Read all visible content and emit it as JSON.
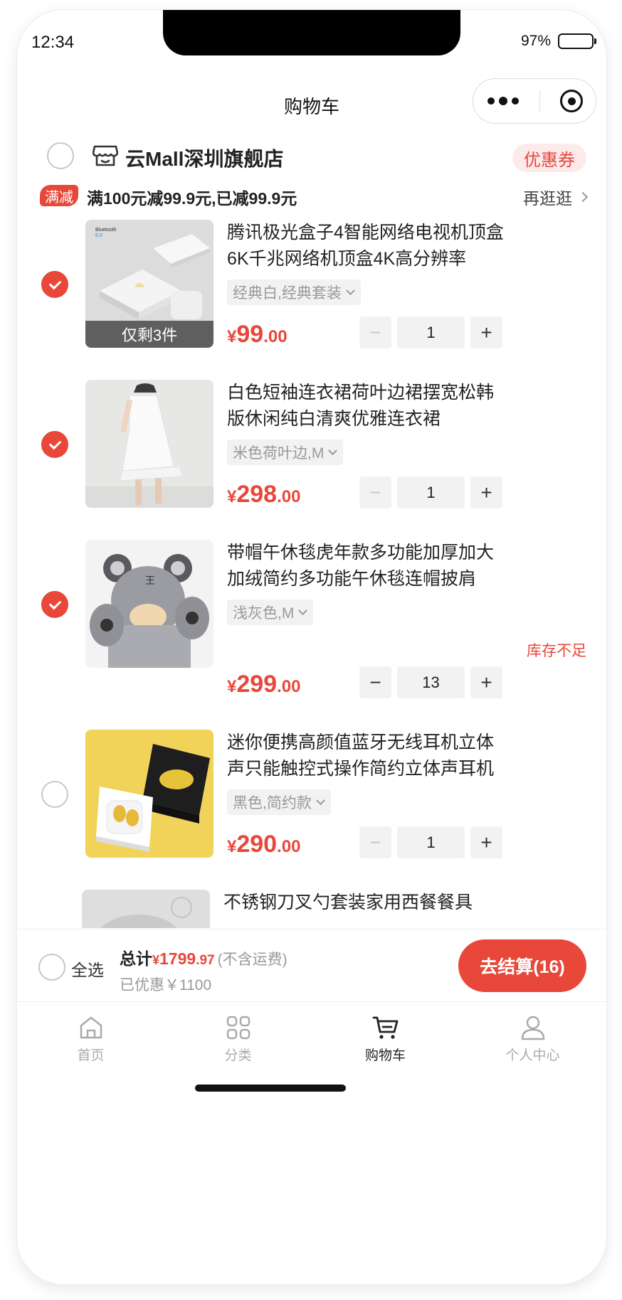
{
  "status_bar": {
    "time": "12:34",
    "battery": "97%"
  },
  "nav": {
    "title": "购物车"
  },
  "store": {
    "name": "云Mall深圳旗舰店",
    "coupon_label": "优惠券"
  },
  "promo": {
    "tag": "满减",
    "text": "满100元减99.9元,已减99.9元",
    "more_label": "再逛逛"
  },
  "items": [
    {
      "title": "腾讯极光盒子4智能网络电视机顶盒6K千兆网络机顶盒4K高分辨率",
      "spec": "经典白,经典套装",
      "price_currency": "¥",
      "price_int": "99",
      "price_dec": ".00",
      "quantity": "1",
      "checked": true,
      "stock_note": "仅剩3件",
      "image_label": "Bluetooth 5.0"
    },
    {
      "title": "白色短袖连衣裙荷叶边裙摆宽松韩版休闲纯白清爽优雅连衣裙",
      "spec": "米色荷叶边,M",
      "price_currency": "¥",
      "price_int": "298",
      "price_dec": ".00",
      "quantity": "1",
      "checked": true
    },
    {
      "title": "带帽午休毯虎年款多功能加厚加大加绒简约多功能午休毯连帽披肩",
      "spec": "浅灰色,M",
      "price_currency": "¥",
      "price_int": "299",
      "price_dec": ".00",
      "quantity": "13",
      "checked": true,
      "warning": "库存不足"
    },
    {
      "title": "迷你便携高颜值蓝牙无线耳机立体声只能触控式操作简约立体声耳机",
      "spec": "黑色,简约款",
      "price_currency": "¥",
      "price_int": "290",
      "price_dec": ".00",
      "quantity": "1",
      "checked": false
    },
    {
      "title": "不锈钢刀叉勺套装家用西餐餐具"
    }
  ],
  "stepper": {
    "minus": "−",
    "plus": "+"
  },
  "checkout": {
    "select_all": "全选",
    "total_label": "总计",
    "total_currency": "¥",
    "total_int": "1799",
    "total_dec": ".97",
    "total_note": "(不含运费)",
    "saved": "已优惠￥1100",
    "button": "去结算(16)"
  },
  "tabbar": [
    {
      "label": "首页",
      "icon": "home-icon",
      "active": false
    },
    {
      "label": "分类",
      "icon": "category-icon",
      "active": false
    },
    {
      "label": "购物车",
      "icon": "cart-icon",
      "active": true
    },
    {
      "label": "个人中心",
      "icon": "profile-icon",
      "active": false
    }
  ],
  "colors": {
    "accent": "#e8473a",
    "coupon_bg": "#fdeaea",
    "muted": "#999999"
  }
}
